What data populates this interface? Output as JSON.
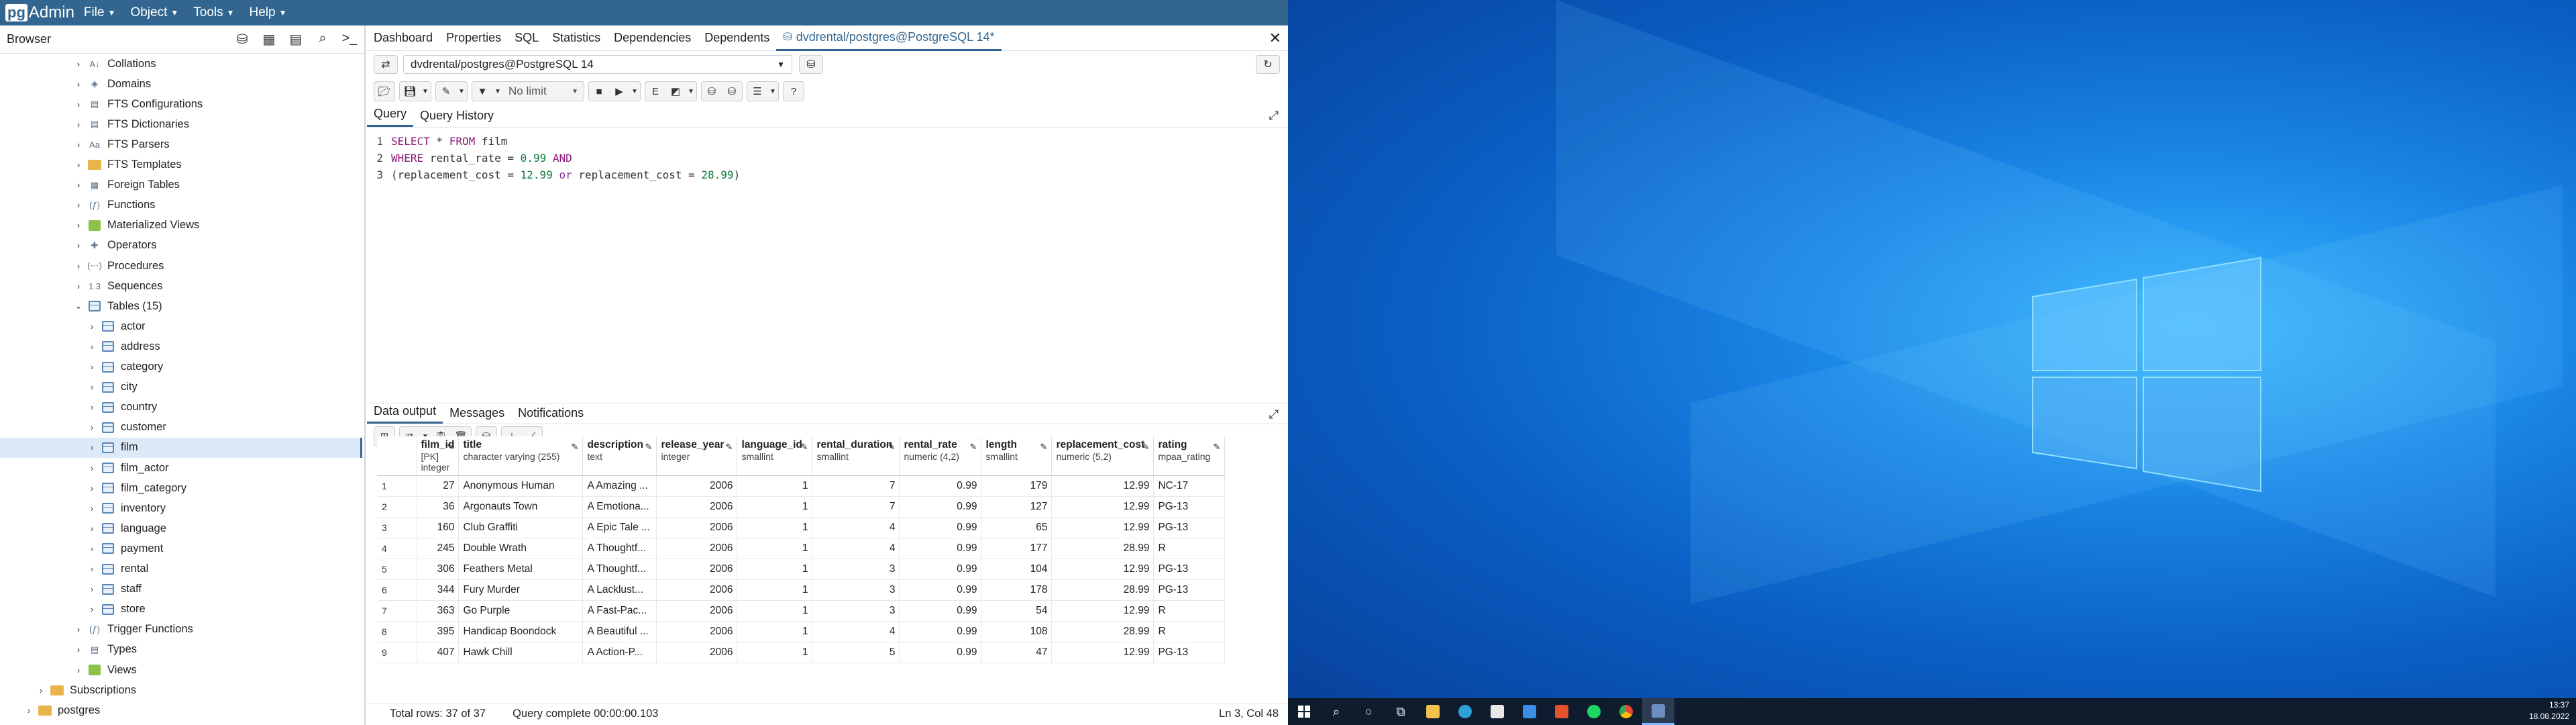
{
  "app": {
    "logo_pg": "pg",
    "logo_admin": "Admin",
    "menus": [
      "File",
      "Object",
      "Tools",
      "Help"
    ]
  },
  "browser": {
    "title": "Browser",
    "tree": [
      {
        "label": "Collations",
        "level": 1,
        "icon": "collation-icon",
        "glyph": "A↓"
      },
      {
        "label": "Domains",
        "level": 1,
        "icon": "domain-icon",
        "glyph": "◈"
      },
      {
        "label": "FTS Configurations",
        "level": 1,
        "icon": "fts-config-icon",
        "glyph": "▤"
      },
      {
        "label": "FTS Dictionaries",
        "level": 1,
        "icon": "fts-dictionary-icon",
        "glyph": "▤"
      },
      {
        "label": "FTS Parsers",
        "level": 1,
        "icon": "fts-parser-icon",
        "glyph": "Aa"
      },
      {
        "label": "FTS Templates",
        "level": 1,
        "icon": "fts-template-icon",
        "glyph": "▦"
      },
      {
        "label": "Foreign Tables",
        "level": 1,
        "icon": "foreign-table-icon",
        "glyph": "▦"
      },
      {
        "label": "Functions",
        "level": 1,
        "icon": "function-icon",
        "glyph": "(ƒ)"
      },
      {
        "label": "Materialized Views",
        "level": 1,
        "icon": "materialized-view-icon",
        "glyph": "■"
      },
      {
        "label": "Operators",
        "level": 1,
        "icon": "operator-icon",
        "glyph": "✚"
      },
      {
        "label": "Procedures",
        "level": 1,
        "icon": "procedure-icon",
        "glyph": "(⋯)"
      },
      {
        "label": "Sequences",
        "level": 1,
        "icon": "sequence-icon",
        "glyph": "1.3"
      },
      {
        "label": "Tables (15)",
        "level": 1,
        "icon": "tables-icon",
        "glyph": "▦",
        "expanded": true
      },
      {
        "label": "actor",
        "level": 2,
        "icon": "table-icon"
      },
      {
        "label": "address",
        "level": 2,
        "icon": "table-icon"
      },
      {
        "label": "category",
        "level": 2,
        "icon": "table-icon"
      },
      {
        "label": "city",
        "level": 2,
        "icon": "table-icon"
      },
      {
        "label": "country",
        "level": 2,
        "icon": "table-icon"
      },
      {
        "label": "customer",
        "level": 2,
        "icon": "table-icon"
      },
      {
        "label": "film",
        "level": 2,
        "icon": "table-icon",
        "selected": true
      },
      {
        "label": "film_actor",
        "level": 2,
        "icon": "table-icon"
      },
      {
        "label": "film_category",
        "level": 2,
        "icon": "table-icon"
      },
      {
        "label": "inventory",
        "level": 2,
        "icon": "table-icon"
      },
      {
        "label": "language",
        "level": 2,
        "icon": "table-icon"
      },
      {
        "label": "payment",
        "level": 2,
        "icon": "table-icon"
      },
      {
        "label": "rental",
        "level": 2,
        "icon": "table-icon"
      },
      {
        "label": "staff",
        "level": 2,
        "icon": "table-icon"
      },
      {
        "label": "store",
        "level": 2,
        "icon": "table-icon"
      },
      {
        "label": "Trigger Functions",
        "level": 1,
        "icon": "trigger-function-icon",
        "glyph": "(ƒ)"
      },
      {
        "label": "Types",
        "level": 1,
        "icon": "type-icon",
        "glyph": "▤"
      },
      {
        "label": "Views",
        "level": 1,
        "icon": "view-icon",
        "glyph": "■"
      },
      {
        "label": "Subscriptions",
        "level": 0,
        "icon": "subscription-icon",
        "glyph": "✉"
      },
      {
        "label": "postgres",
        "level": -1,
        "icon": "database-icon",
        "glyph": "▦"
      }
    ]
  },
  "tabs": [
    "Dashboard",
    "Properties",
    "SQL",
    "Statistics",
    "Dependencies",
    "Dependents",
    "dvdrental/postgres@PostgreSQL 14*"
  ],
  "connection": {
    "value": "dvdrental/postgres@PostgreSQL 14"
  },
  "toolbar": {
    "limit": "No limit"
  },
  "query_tabs": [
    "Query",
    "Query History"
  ],
  "editor": {
    "lines": [
      [
        {
          "t": "SELECT",
          "c": "kw"
        },
        {
          "t": " * ",
          "c": "ident"
        },
        {
          "t": "FROM",
          "c": "kw"
        },
        {
          "t": " film",
          "c": "ident"
        }
      ],
      [
        {
          "t": "WHERE",
          "c": "kw"
        },
        {
          "t": " rental_rate = ",
          "c": "ident"
        },
        {
          "t": "0.99",
          "c": "num"
        },
        {
          "t": " ",
          "c": "ident"
        },
        {
          "t": "AND",
          "c": "kw"
        }
      ],
      [
        {
          "t": "(replacement_cost = ",
          "c": "ident"
        },
        {
          "t": "12.99",
          "c": "num"
        },
        {
          "t": " ",
          "c": "ident"
        },
        {
          "t": "or",
          "c": "kw2"
        },
        {
          "t": " replacement_cost = ",
          "c": "ident"
        },
        {
          "t": "28.99",
          "c": "num"
        },
        {
          "t": ")",
          "c": "ident"
        }
      ]
    ]
  },
  "result_tabs": [
    "Data output",
    "Messages",
    "Notifications"
  ],
  "grid": {
    "columns": [
      {
        "name": "film_id",
        "type": "[PK] integer"
      },
      {
        "name": "title",
        "type": "character varying (255)"
      },
      {
        "name": "description",
        "type": "text"
      },
      {
        "name": "release_year",
        "type": "integer"
      },
      {
        "name": "language_id",
        "type": "smallint"
      },
      {
        "name": "rental_duration",
        "type": "smallint"
      },
      {
        "name": "rental_rate",
        "type": "numeric (4,2)"
      },
      {
        "name": "length",
        "type": "smallint"
      },
      {
        "name": "replacement_cost",
        "type": "numeric (5,2)"
      },
      {
        "name": "rating",
        "type": "mpaa_rating"
      }
    ],
    "rows": [
      [
        "1",
        "27",
        "Anonymous Human",
        "A Amazing ...",
        "2006",
        "1",
        "7",
        "0.99",
        "179",
        "12.99",
        "NC-17"
      ],
      [
        "2",
        "36",
        "Argonauts Town",
        "A Emotiona...",
        "2006",
        "1",
        "7",
        "0.99",
        "127",
        "12.99",
        "PG-13"
      ],
      [
        "3",
        "160",
        "Club Graffiti",
        "A Epic Tale ...",
        "2006",
        "1",
        "4",
        "0.99",
        "65",
        "12.99",
        "PG-13"
      ],
      [
        "4",
        "245",
        "Double Wrath",
        "A Thoughtf...",
        "2006",
        "1",
        "4",
        "0.99",
        "177",
        "28.99",
        "R"
      ],
      [
        "5",
        "306",
        "Feathers Metal",
        "A Thoughtf...",
        "2006",
        "1",
        "3",
        "0.99",
        "104",
        "12.99",
        "PG-13"
      ],
      [
        "6",
        "344",
        "Fury Murder",
        "A Lacklust...",
        "2006",
        "1",
        "3",
        "0.99",
        "178",
        "28.99",
        "PG-13"
      ],
      [
        "7",
        "363",
        "Go Purple",
        "A Fast-Pac...",
        "2006",
        "1",
        "3",
        "0.99",
        "54",
        "12.99",
        "R"
      ],
      [
        "8",
        "395",
        "Handicap Boondock",
        "A Beautiful ...",
        "2006",
        "1",
        "4",
        "0.99",
        "108",
        "28.99",
        "R"
      ],
      [
        "9",
        "407",
        "Hawk Chill",
        "A Action-P...",
        "2006",
        "1",
        "5",
        "0.99",
        "47",
        "12.99",
        "PG-13"
      ]
    ]
  },
  "status": {
    "rows": "Total rows: 37 of 37",
    "time": "Query complete 00:00:00.103",
    "position": "Ln 3, Col 48"
  },
  "taskbar": {
    "time": "13:37",
    "date": "18.08.2022"
  }
}
